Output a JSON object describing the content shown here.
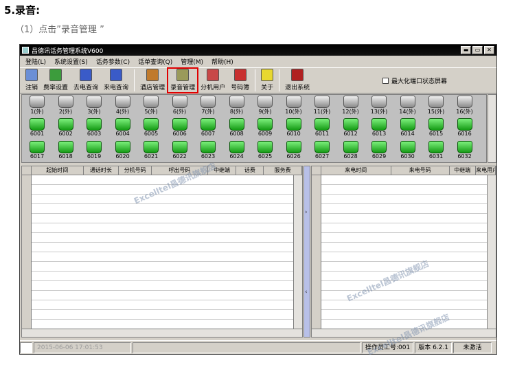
{
  "heading": "5.录音:",
  "step": "（1）点击”录音管理 ”",
  "window": {
    "title": "昌德讯话务管理系统V600",
    "controls": {
      "minimize": "▬",
      "maximize": "▭",
      "close": "✕"
    }
  },
  "menu": [
    "登陆(L)",
    "系统设置(S)",
    "话务参数(C)",
    "话单查询(Q)",
    "管理(M)",
    "帮助(H)"
  ],
  "toolbar": [
    {
      "label": "注销",
      "icon": "logout-icon",
      "color": "#6b8fd6"
    },
    {
      "label": "费率设置",
      "icon": "rate-icon",
      "color": "#3c9c3c"
    },
    {
      "label": "去电查询",
      "icon": "outgoing-icon",
      "color": "#3a5bc8"
    },
    {
      "label": "来电查询",
      "icon": "incoming-icon",
      "color": "#3a5bc8"
    },
    {
      "label": "酒店管理",
      "icon": "hotel-icon",
      "color": "#c07a2c"
    },
    {
      "label": "录音管理",
      "icon": "recording-icon",
      "color": "#9a9a5a",
      "highlight": true
    },
    {
      "label": "分机用户",
      "icon": "extension-user-icon",
      "color": "#c84848"
    },
    {
      "label": "号码簿",
      "icon": "phonebook-icon",
      "color": "#c83030"
    },
    {
      "label": "关于",
      "icon": "lightbulb-icon",
      "color": "#e8d830"
    },
    {
      "label": "退出系统",
      "icon": "exit-icon",
      "color": "#b02020"
    }
  ],
  "checkbox_label": "最大化端口状态屏幕",
  "trunk_lines": [
    "1(外)",
    "2(外)",
    "3(外)",
    "4(外)",
    "5(外)",
    "6(外)",
    "7(外)",
    "8(外)",
    "9(外)",
    "10(外)",
    "11(外)",
    "12(外)",
    "13(外)",
    "14(外)",
    "15(外)",
    "16(外)"
  ],
  "extensions_row1": [
    "6001",
    "6002",
    "6003",
    "6004",
    "6005",
    "6006",
    "6007",
    "6008",
    "6009",
    "6010",
    "6011",
    "6012",
    "6013",
    "6014",
    "6015",
    "6016"
  ],
  "extensions_row2": [
    "6017",
    "6018",
    "6019",
    "6020",
    "6021",
    "6022",
    "6023",
    "6024",
    "6025",
    "6026",
    "6027",
    "6028",
    "6029",
    "6030",
    "6031",
    "6032"
  ],
  "outgoing_columns": [
    "起始时间",
    "通话时长",
    "分机号码",
    "呼出号码",
    "中继端",
    "话费",
    "服务费"
  ],
  "incoming_columns": [
    "来电时间",
    "来电号码",
    "中继端",
    "来电用户"
  ],
  "splitter": {
    "right_arrow": "›",
    "left_arrow": "‹"
  },
  "status": {
    "datetime": "2015-06-06 17:01:53",
    "operator": "操作员工号:001",
    "version": "版本 6.2.1",
    "activation": "未激活"
  },
  "watermarks": [
    "Excelltel昌德讯旗舰店",
    "Excelltel昌德讯旗舰店",
    "Excelltel昌德讯旗舰店"
  ]
}
